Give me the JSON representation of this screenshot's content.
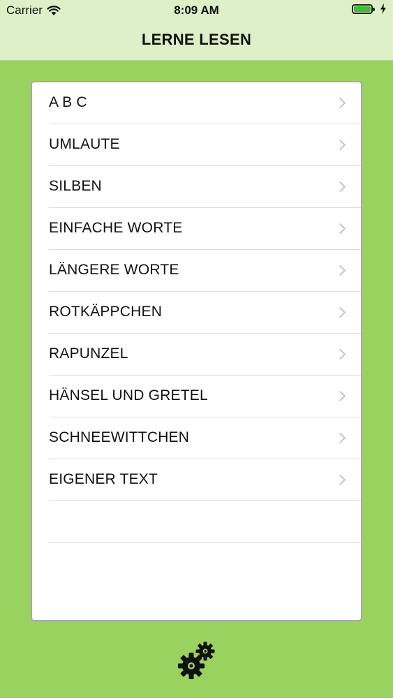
{
  "status_bar": {
    "carrier": "Carrier",
    "time": "8:09 AM",
    "battery_level": 1.0
  },
  "nav_bar": {
    "title": "LERNE LESEN"
  },
  "menu": {
    "items": [
      {
        "label": "A B C"
      },
      {
        "label": "UMLAUTE"
      },
      {
        "label": "SILBEN"
      },
      {
        "label": "EINFACHE WORTE"
      },
      {
        "label": "LÄNGERE WORTE"
      },
      {
        "label": "ROTKÄPPCHEN"
      },
      {
        "label": "RAPUNZEL"
      },
      {
        "label": "HÄNSEL UND GRETEL"
      },
      {
        "label": "SCHNEEWITTCHEN"
      },
      {
        "label": "EIGENER TEXT"
      }
    ]
  },
  "footer": {
    "settings_icon": "gears-icon"
  },
  "colors": {
    "background": "#9ad25f",
    "bar_background": "#ddf0c8",
    "battery_fill": "#3cc03c"
  }
}
